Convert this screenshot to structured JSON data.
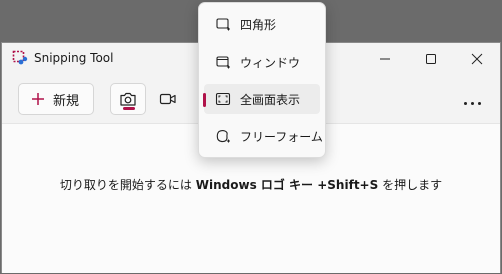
{
  "window": {
    "title": "Snipping Tool"
  },
  "toolbar": {
    "new_label": "新規"
  },
  "main": {
    "hint_before": "切り取りを開始するには ",
    "hint_keys": "Windows ロゴ キー +Shift+S",
    "hint_after": " を押します"
  },
  "dropdown": {
    "items": [
      {
        "label": "四角形",
        "selected": false
      },
      {
        "label": "ウィンドウ",
        "selected": false
      },
      {
        "label": "全画面表示",
        "selected": true
      },
      {
        "label": "フリーフォーム",
        "selected": false
      }
    ]
  },
  "colors": {
    "accent": "#b0124a",
    "window_bg": "#f3f3f3",
    "content_bg": "#fbfbfb",
    "desktop": "#6b6b6b"
  }
}
